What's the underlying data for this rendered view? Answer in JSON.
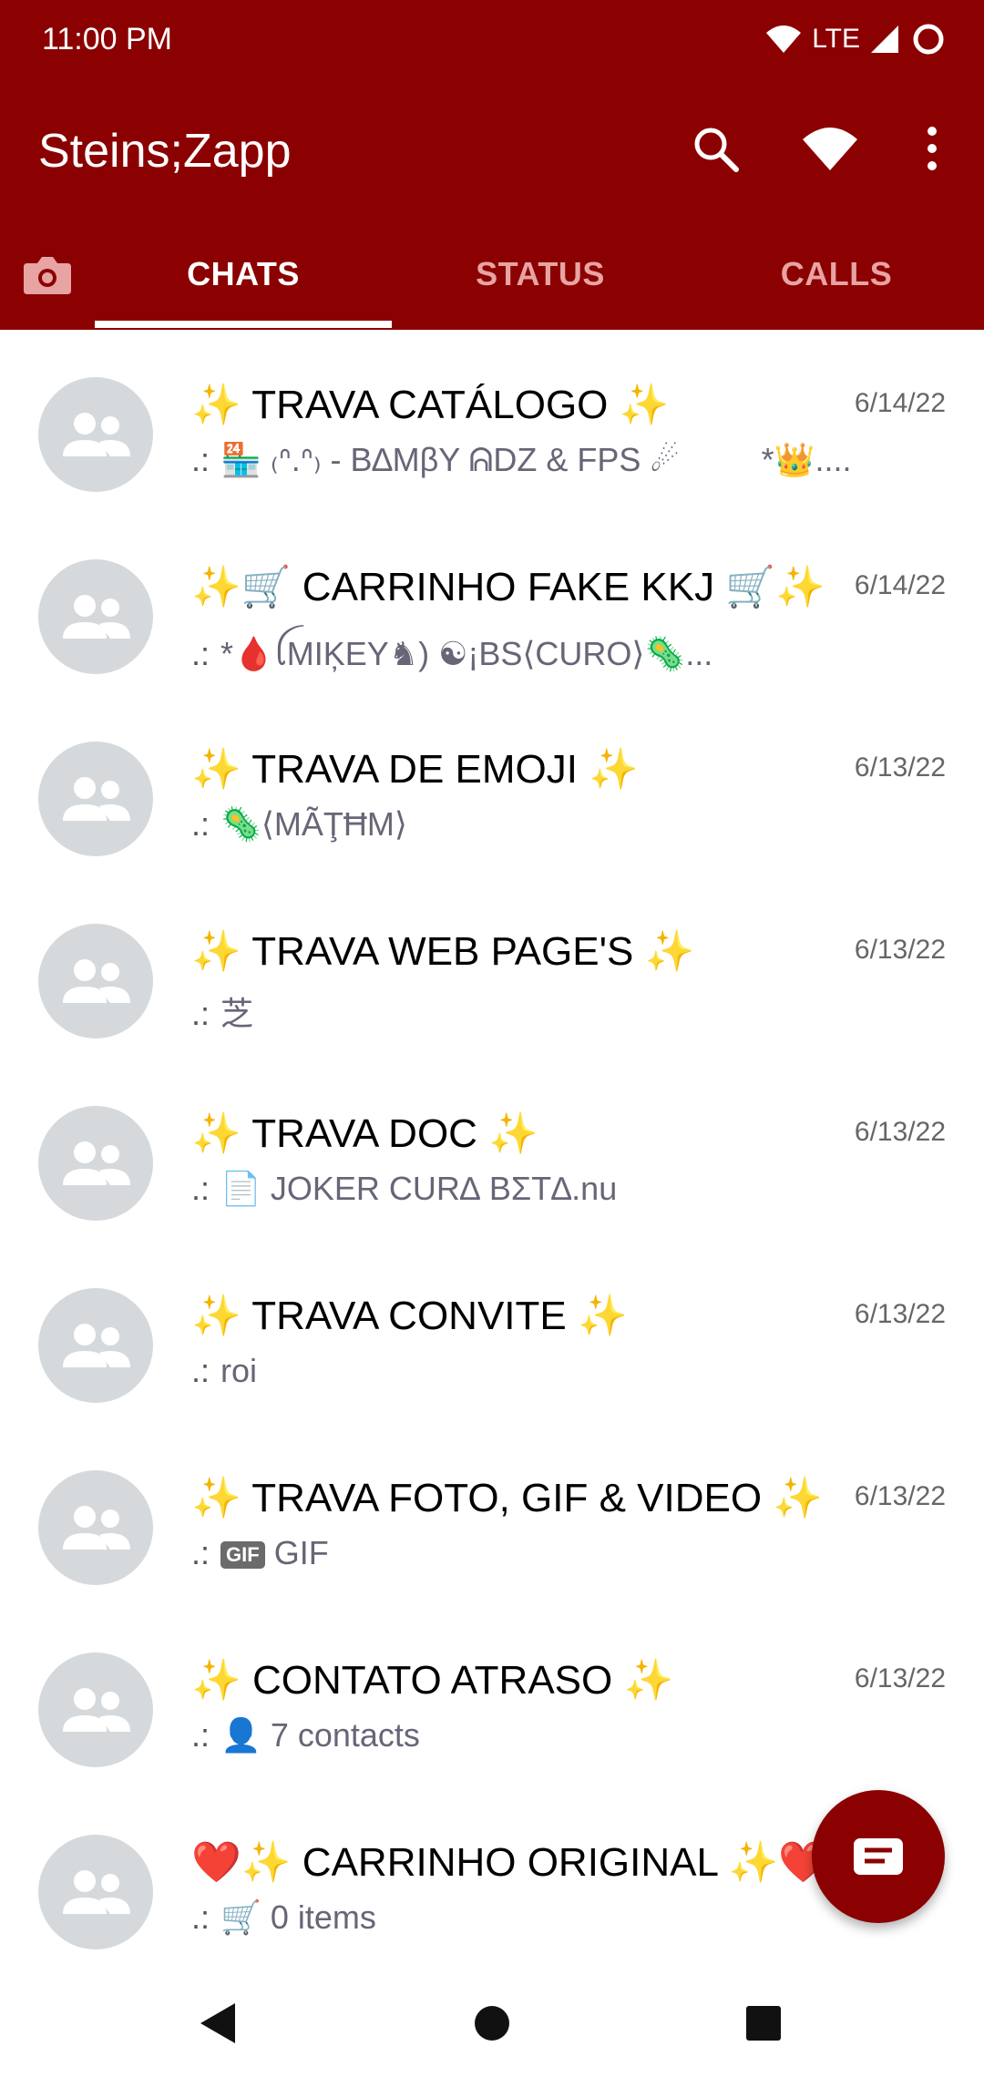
{
  "status_bar": {
    "time": "11:00 PM",
    "network": "LTE"
  },
  "app_bar": {
    "title": "Steins;Zapp"
  },
  "tabs": [
    {
      "label": "CHATS",
      "active": true
    },
    {
      "label": "STATUS",
      "active": false
    },
    {
      "label": "CALLS",
      "active": false
    }
  ],
  "chats": [
    {
      "name": "✨ TRAVA CATÁLOGO ✨",
      "date": "6/14/22",
      "prefix": ".:",
      "message": "🏪 ₍ᐢ.ᐢ₎ - B∆MβY ᕱDZ & FPS ☄",
      "tail": "*👑...."
    },
    {
      "name": "✨🛒 CARRINHO FAKE KKJ 🛒✨",
      "date": "6/14/22",
      "prefix": ".:",
      "message": "*🩸ꪶMIĶEY♞) ☯¡BS⟨CURO⟩🦠...",
      "tail": ""
    },
    {
      "name": "✨ TRAVA DE EMOJI ✨",
      "date": "6/13/22",
      "prefix": ".:",
      "message": "🦠⟨MÃŢĦM⟩",
      "tail": ""
    },
    {
      "name": "✨ TRAVA WEB PAGE'S ✨",
      "date": "6/13/22",
      "prefix": ".:",
      "message": "芝",
      "tail": ""
    },
    {
      "name": "✨ TRAVA DOC ✨",
      "date": "6/13/22",
      "prefix": ".:",
      "message": "📄 JOKER CUR∆ BΣT∆.nu",
      "tail": ""
    },
    {
      "name": "✨ TRAVA CONVITE ✨",
      "date": "6/13/22",
      "prefix": ".:",
      "message": "roi",
      "tail": ""
    },
    {
      "name": "✨ TRAVA FOTO, GIF & VIDEO ✨",
      "date": "6/13/22",
      "prefix": ".:",
      "badge": "GIF",
      "message": "GIF",
      "tail": ""
    },
    {
      "name": "✨ CONTATO ATRASO ✨",
      "date": "6/13/22",
      "prefix": ".:",
      "message": "👤 7 contacts",
      "tail": ""
    },
    {
      "name": "❤️✨ CARRINHO ORIGINAL ✨❤️",
      "date": "",
      "prefix": ".:",
      "message": "🛒 0 items",
      "tail": ""
    }
  ],
  "colors": {
    "primary": "#8b0000",
    "tab_inactive": "#e8a3a3",
    "avatar_bg": "#d6d9dc"
  },
  "icons": {
    "search": "search-icon",
    "wifi": "wifi-icon",
    "more": "more-vert-icon",
    "camera": "camera-icon",
    "group": "group-icon",
    "fab": "new-chat-icon",
    "back": "back-icon",
    "home": "home-icon",
    "recents": "recents-icon"
  }
}
